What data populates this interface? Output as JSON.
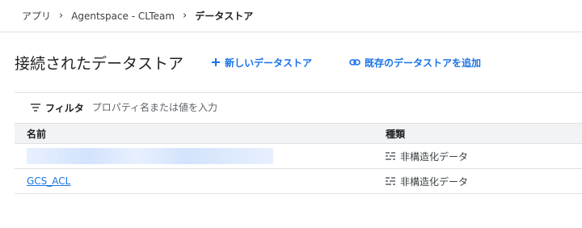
{
  "breadcrumb": {
    "items": [
      "アプリ",
      "Agentspace - CLTeam",
      "データストア"
    ]
  },
  "header": {
    "title": "接続されたデータストア",
    "new_datastore": "新しいデータストア",
    "add_existing": "既存のデータストアを追加"
  },
  "filter": {
    "label": "フィルタ",
    "placeholder": "プロパティ名または値を入力"
  },
  "table": {
    "columns": [
      "名前",
      "種類"
    ],
    "rows": [
      {
        "name": "",
        "type": "非構造化データ"
      },
      {
        "name": "GCS_ACL",
        "type": "非構造化データ"
      }
    ]
  },
  "colors": {
    "accent": "#1a73e8",
    "header_bg": "#f1f3f4",
    "border": "#e0e0e0"
  }
}
